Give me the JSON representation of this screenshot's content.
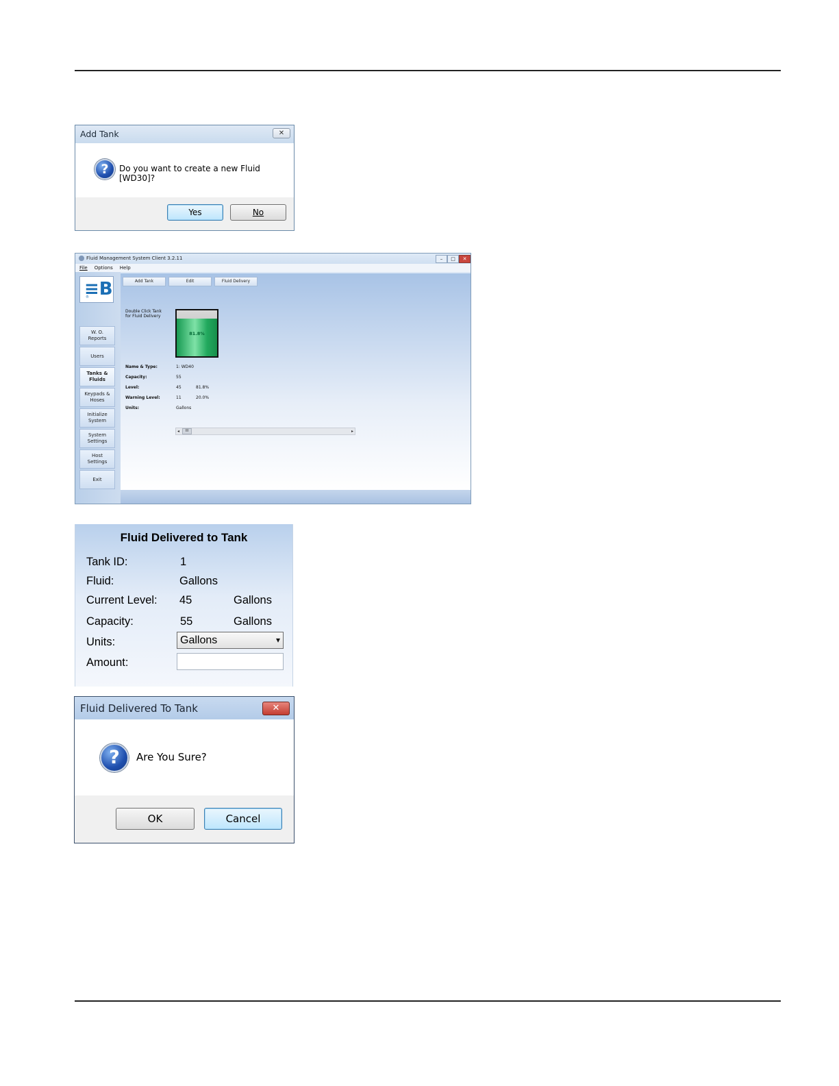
{
  "dialog1": {
    "title": "Add Tank",
    "close_glyph": "✕",
    "question_glyph": "?",
    "message": "Do you want to create a new Fluid [WD30]?",
    "yes_label": "Yes",
    "no_label": "No"
  },
  "app": {
    "title": "Fluid Management System Client 3.2.11",
    "menu": [
      "File",
      "Options",
      "Help"
    ],
    "window_controls": [
      "–",
      "□",
      "✕"
    ],
    "logo_text": "≡B",
    "logo_small": "®",
    "toolbar": {
      "add_tank": "Add Tank",
      "edit": "Edit",
      "fluid_delivery": "Fluid Delivery"
    },
    "nav": [
      {
        "label": "W. O. Reports"
      },
      {
        "label": "Users"
      },
      {
        "label": "Tanks & Fluids"
      },
      {
        "label": "Keypads & Hoses"
      },
      {
        "label": "Initialize System"
      },
      {
        "label": "System Settings"
      },
      {
        "label": "Host Settings"
      },
      {
        "label": "Exit"
      }
    ],
    "hint": "Double Click Tank for Fluid Delivery",
    "tank": {
      "percent_text": "81.8%",
      "fill_fraction": 0.818
    },
    "details": {
      "name_label": "Name & Type:",
      "name_value": "1: WD40",
      "capacity_label": "Capacity:",
      "capacity_value": "55",
      "level_label": "Level:",
      "level_value": "45",
      "level_pct": "81.8%",
      "warning_label": "Warning Level:",
      "warning_value": "11",
      "warning_pct": "20.0%",
      "units_label": "Units:",
      "units_value": "Gallons"
    },
    "scroll": {
      "left": "◂",
      "thumb": "III",
      "right": "▸"
    }
  },
  "fluid_panel": {
    "title": "Fluid Delivered to Tank",
    "tank_id_label": "Tank ID:",
    "tank_id_value": "1",
    "fluid_label": "Fluid:",
    "fluid_value": "Gallons",
    "current_level_label": "Current Level:",
    "current_level_value": "45",
    "current_level_unit": "Gallons",
    "capacity_label": "Capacity:",
    "capacity_value": "55",
    "capacity_unit": "Gallons",
    "units_label": "Units:",
    "units_selected": "Gallons",
    "amount_label": "Amount:",
    "amount_value": "",
    "dropdown_glyph": "▾"
  },
  "dialog2": {
    "title": "Fluid Delivered To Tank",
    "close_glyph": "✕",
    "question_glyph": "?",
    "message": "Are You Sure?",
    "ok_label": "OK",
    "cancel_label": "Cancel"
  },
  "colors": {
    "tank_fill": "#2fbf6a",
    "close_red": "#c9463d"
  }
}
